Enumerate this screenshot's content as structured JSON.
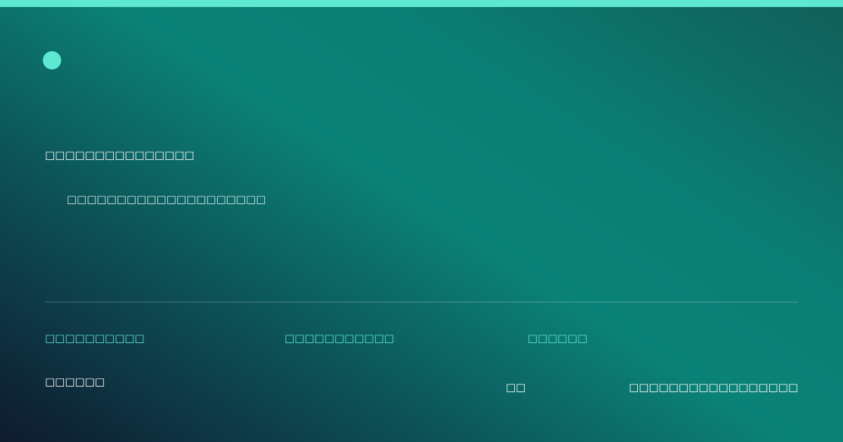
{
  "colors": {
    "accent": "#5ee8d2",
    "gradient_dark": "#0f1a2e",
    "gradient_mid": "#0b8277",
    "gradient_end": "#115e58"
  },
  "card": {
    "logo_icon": "circle-dot-icon",
    "headline": "□□□□□□□□□□□□□□□",
    "subtitle": "□□□□□□□□□□□□□□□□□□□□"
  },
  "stats": [
    {
      "label": "□□□□□□□□□□"
    },
    {
      "label": "□□□□□□□□□□□"
    },
    {
      "label": "□□□□□□"
    }
  ],
  "footer": {
    "left": "□□□□□□",
    "middle": "□□",
    "right": "□□□□□□□□□□□□□□□□□"
  }
}
